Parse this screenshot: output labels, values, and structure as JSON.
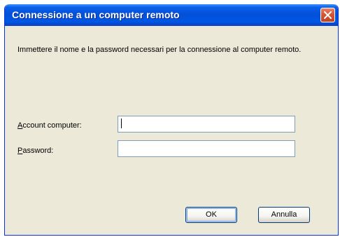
{
  "window": {
    "title": "Connessione a un computer remoto",
    "close_label": "Chiudi"
  },
  "intro_text": "Immettere il nome e la password necessari per la connessione al computer remoto.",
  "fields": {
    "account": {
      "label_accel": "A",
      "label_rest": "ccount computer:",
      "value": ""
    },
    "password": {
      "label_accel": "P",
      "label_rest": "assword:",
      "value": ""
    }
  },
  "buttons": {
    "ok": "OK",
    "cancel": "Annulla"
  },
  "colors": {
    "titlebar": "#0350d8",
    "face": "#ece9d8",
    "close": "#d65a38"
  },
  "icons": {
    "close": "close-icon"
  }
}
